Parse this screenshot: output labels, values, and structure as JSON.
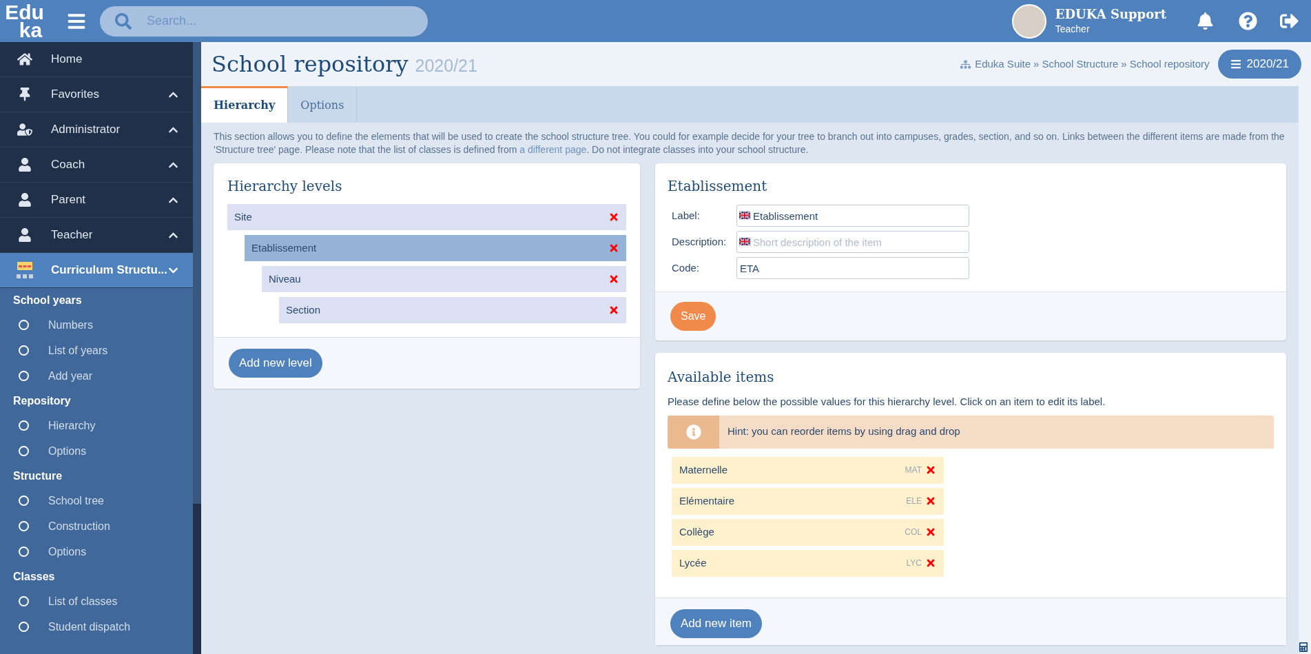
{
  "topbar": {
    "logo_top": "Edu",
    "logo_bottom": "ka",
    "search": {
      "placeholder": "Search..."
    },
    "user": {
      "name": "EDUKA Support",
      "role": "Teacher"
    }
  },
  "sidebar": {
    "menu": [
      {
        "label": "Home",
        "kind": "home",
        "selected": false
      },
      {
        "label": "Favorites",
        "kind": "pin",
        "expanded": false,
        "selected": false
      },
      {
        "label": "Administrator",
        "kind": "admin",
        "expanded": false,
        "selected": false
      },
      {
        "label": "Coach",
        "kind": "user",
        "expanded": false,
        "selected": false
      },
      {
        "label": "Parent",
        "kind": "user",
        "expanded": false,
        "selected": false
      },
      {
        "label": "Teacher",
        "kind": "user",
        "expanded": false,
        "selected": false
      },
      {
        "label": "Curriculum Structu...",
        "kind": "structure",
        "expanded": true,
        "selected": true
      }
    ],
    "groups": [
      {
        "heading": "School years",
        "items": [
          "Numbers",
          "List of years",
          "Add year"
        ]
      },
      {
        "heading": "Repository",
        "items": [
          "Hierarchy",
          "Options"
        ]
      },
      {
        "heading": "Structure",
        "items": [
          "School tree",
          "Construction",
          "Options"
        ]
      },
      {
        "heading": "Classes",
        "items": [
          "List of classes",
          "Student dispatch"
        ]
      }
    ]
  },
  "page": {
    "title": "School repository",
    "year": "2020/21",
    "breadcrumb": [
      "Eduka Suite",
      "School Structure",
      "School repository"
    ],
    "breadcrumb_separator": "»",
    "year_button": "2020/21"
  },
  "tabs": [
    {
      "label": "Hierarchy",
      "selected": true
    },
    {
      "label": "Options",
      "selected": false
    }
  ],
  "intro": {
    "before": "This section allows you to define the elements that will be used to create the school structure tree. You could for example decide for your tree to branch out into campuses, grades, section, and so on. Links between the different items are made from the 'Structure tree' page. Please note that the list of classes is defined from ",
    "link": "a different page",
    "after": ". Do not integrate classes into your school structure."
  },
  "hierarchy": {
    "title": "Hierarchy levels",
    "levels": [
      {
        "label": "Site",
        "selected": false,
        "children": [
          {
            "label": "Etablissement",
            "selected": true,
            "children": [
              {
                "label": "Niveau",
                "selected": false,
                "children": [
                  {
                    "label": "Section",
                    "selected": false
                  }
                ]
              }
            ]
          }
        ]
      }
    ],
    "add_button": "Add new level"
  },
  "detail": {
    "title": "Etablissement",
    "fields": [
      {
        "label": "Label:",
        "value": "Etablissement",
        "flag": true
      },
      {
        "label": "Description:",
        "placeholder": "Short description of the item",
        "flag": true
      },
      {
        "label": "Code:",
        "value": "ETA",
        "flag": false
      }
    ],
    "save_button": "Save"
  },
  "available": {
    "title": "Available items",
    "description": "Please define below the possible values for this hierarchy level. Click on an item to edit its label.",
    "hint": "Hint: you can reorder items by using drag and drop",
    "items": [
      {
        "label": "Maternelle",
        "code": "MAT"
      },
      {
        "label": "Elémentaire",
        "code": "ELE"
      },
      {
        "label": "Collège",
        "code": "COL"
      },
      {
        "label": "Lycée",
        "code": "LYC"
      }
    ],
    "add_button": "Add new item"
  }
}
